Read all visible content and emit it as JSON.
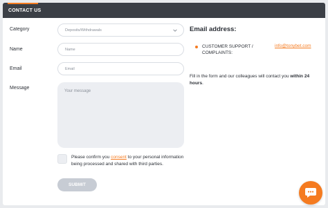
{
  "header": {
    "title": "CONTACT US"
  },
  "form": {
    "category_label": "Category",
    "category_value": "Deposits/Withdrawals",
    "name_label": "Name",
    "name_placeholder": "Name",
    "email_label": "Email",
    "email_placeholder": "Email",
    "message_label": "Message",
    "message_placeholder": "Your message",
    "consent_before": "Please confirm you ",
    "consent_link": "consent",
    "consent_after": " to your personal information being processed and shared with third parties.",
    "submit_label": "SUBMIT"
  },
  "contact": {
    "title": "Email address:",
    "support_label": "CUSTOMER SUPPORT / COMPLAINTS:",
    "support_email": "info@tonybet.com",
    "info_before": "Fill in the form and our colleagues will contact you ",
    "info_bold": "within 24 hours",
    "info_after": "."
  },
  "colors": {
    "accent": "#f57b20",
    "header_bg": "#3b3f46",
    "submit_disabled": "#c7ccd4"
  },
  "icons": {
    "chevron": "chevron-down-icon",
    "chat": "chat-icon"
  }
}
